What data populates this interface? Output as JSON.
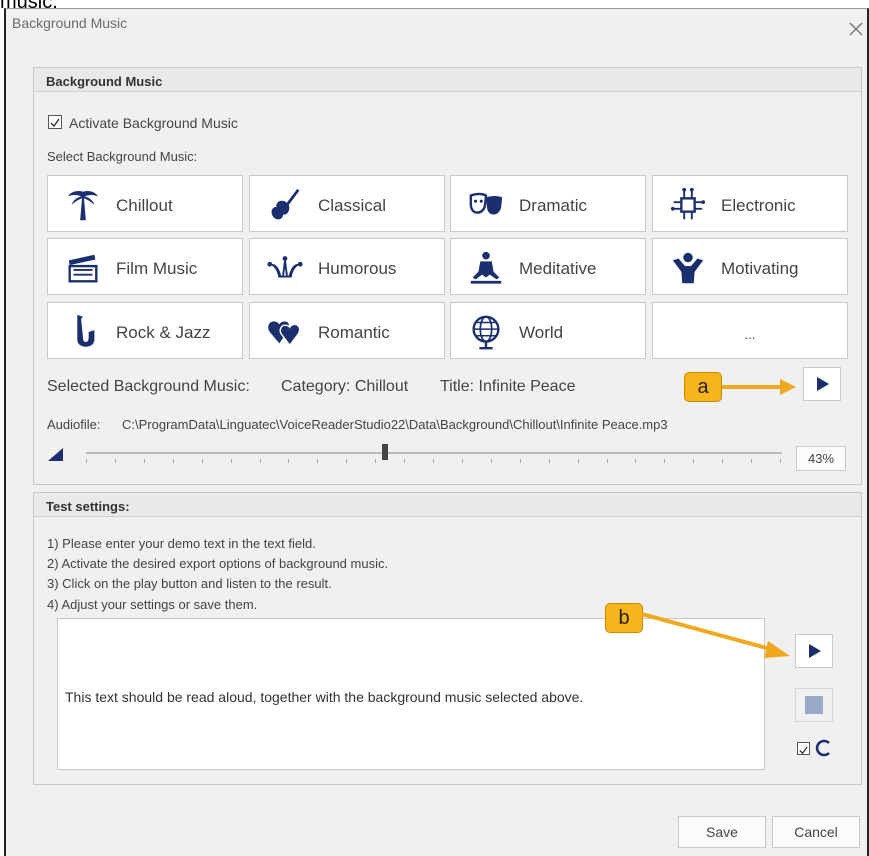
{
  "clip_caption": "music.",
  "window": {
    "title": "Background Music"
  },
  "music_panel": {
    "header": "Background Music",
    "activate_label": "Activate Background Music",
    "activate_checked": true,
    "select_label": "Select Background Music:",
    "categories": [
      {
        "label": "Chillout",
        "icon": "palm-tree-icon"
      },
      {
        "label": "Classical",
        "icon": "violin-icon"
      },
      {
        "label": "Dramatic",
        "icon": "theater-masks-icon"
      },
      {
        "label": "Electronic",
        "icon": "circuit-chip-icon"
      },
      {
        "label": "Film Music",
        "icon": "clapperboard-icon"
      },
      {
        "label": "Humorous",
        "icon": "jester-hat-icon"
      },
      {
        "label": "Meditative",
        "icon": "meditation-icon"
      },
      {
        "label": "Motivating",
        "icon": "cheering-person-icon"
      },
      {
        "label": "Rock & Jazz",
        "icon": "saxophone-icon"
      },
      {
        "label": "Romantic",
        "icon": "hearts-icon"
      },
      {
        "label": "World",
        "icon": "globe-icon"
      },
      {
        "label": "...",
        "icon": ""
      }
    ],
    "selected_label": "Selected Background Music:",
    "selected_category": "Category: Chillout",
    "selected_title": "Title: Infinite Peace",
    "audiofile_label": "Audiofile:",
    "audiofile_path": "C:\\ProgramData\\Linguatec\\VoiceReaderStudio22\\Data\\Background\\Chillout\\Infinite Peace.mp3",
    "volume_percent": 43,
    "volume_text": "43%"
  },
  "test_panel": {
    "header": "Test settings:",
    "instructions": [
      "1) Please enter your demo text in the text field.",
      "2) Activate the desired export options of background music.",
      "3) Click on the play button and listen to the result.",
      "4) Adjust your settings or save them."
    ],
    "demo_text": "This text should be read aloud, together with the background music selected above.",
    "loop_checked": true
  },
  "callouts": {
    "a": "a",
    "b": "b"
  },
  "footer": {
    "save_label": "Save",
    "cancel_label": "Cancel"
  },
  "colors": {
    "accent": "#1b2f6e",
    "callout": "#f7b41b",
    "arrow": "#f0a81e",
    "icon_blue": "#1b2f6e"
  }
}
